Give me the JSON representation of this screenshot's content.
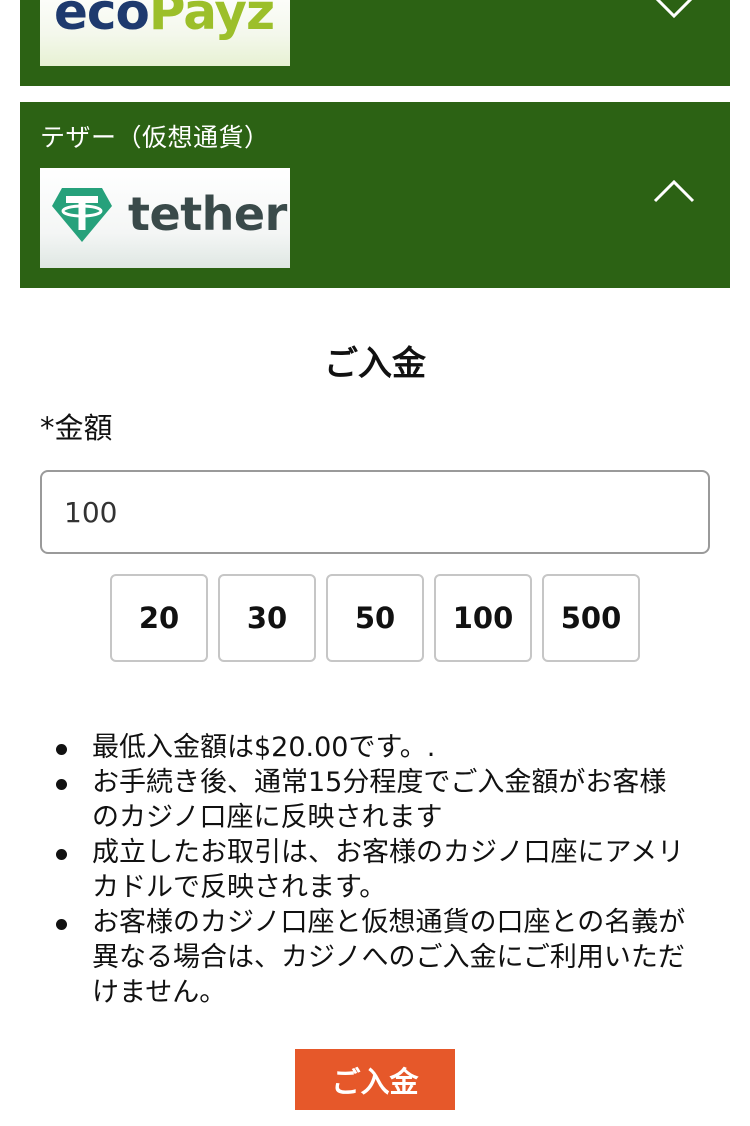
{
  "methods": [
    {
      "logo_text_part1": "eco",
      "logo_text_part2": "Payz",
      "chevron": "chevron-down-icon"
    },
    {
      "label": "テザー（仮想通貨）",
      "logo_text": "tether",
      "chevron": "chevron-up-icon"
    }
  ],
  "deposit": {
    "title": "ご入金",
    "amount_label": "*金額",
    "amount_value": "100",
    "quick_amounts": [
      "20",
      "30",
      "50",
      "100",
      "500"
    ],
    "notes": [
      "最低入金額は$20.00です。.",
      "お手続き後、通常15分程度でご入金額がお客様のカジノ口座に反映されます",
      "成立したお取引は、お客様のカジノ口座にアメリカドルで反映されます。",
      "お客様のカジノ口座と仮想通貨の口座との名義が異なる場合は、カジノへのご入金にご利用いただけません。"
    ],
    "submit_label": "ご入金"
  },
  "colors": {
    "panel_green": "#2c6214",
    "submit_orange": "#e6582a",
    "ecopayz_navy": "#1e3a6e",
    "ecopayz_green": "#9cbf2a",
    "tether_teal": "#26a17b"
  }
}
